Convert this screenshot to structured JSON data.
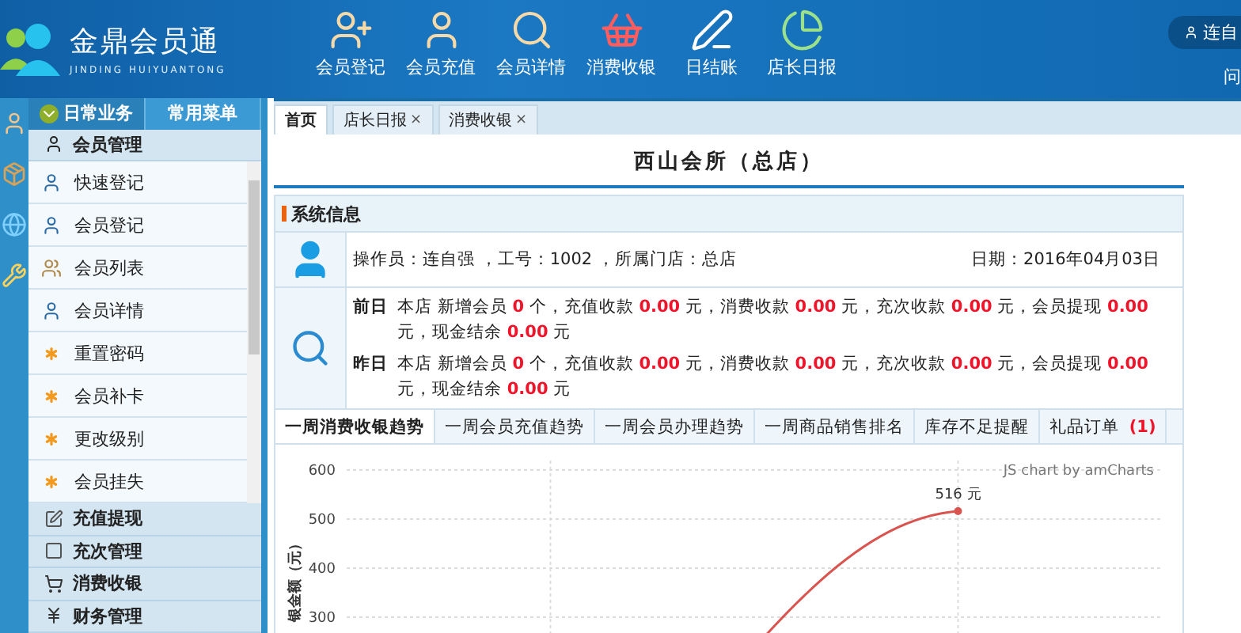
{
  "header": {
    "logo_title": "金鼎会员通",
    "logo_subtitle": "JINDING HUIYUANTONG",
    "user_name": "连自",
    "help_link": "问"
  },
  "toolbar": [
    {
      "label": "会员登记",
      "kind": "member-add"
    },
    {
      "label": "会员充值",
      "kind": "member-charge"
    },
    {
      "label": "会员详情",
      "kind": "member-detail"
    },
    {
      "label": "消费收银",
      "kind": "basket"
    },
    {
      "label": "日结账",
      "kind": "ledger"
    },
    {
      "label": "店长日报",
      "kind": "report"
    }
  ],
  "sidebar": {
    "tabs": [
      {
        "label": "日常业务",
        "selected": true
      },
      {
        "label": "常用菜单",
        "selected": false
      }
    ],
    "groups": [
      {
        "label": "会员管理",
        "kind": "member",
        "expanded": true,
        "items": [
          {
            "label": "快速登记",
            "kind": "person"
          },
          {
            "label": "会员登记",
            "kind": "person"
          },
          {
            "label": "会员列表",
            "kind": "people"
          },
          {
            "label": "会员详情",
            "kind": "person"
          },
          {
            "label": "重置密码",
            "kind": "star"
          },
          {
            "label": "会员补卡",
            "kind": "star"
          },
          {
            "label": "更改级别",
            "kind": "star"
          },
          {
            "label": "会员挂失",
            "kind": "star"
          }
        ]
      },
      {
        "label": "充值提现",
        "kind": "note",
        "expanded": false
      },
      {
        "label": "充次管理",
        "kind": "square",
        "expanded": false
      },
      {
        "label": "消费收银",
        "kind": "cart",
        "expanded": false
      },
      {
        "label": "财务管理",
        "kind": "yen",
        "expanded": false
      }
    ]
  },
  "page_tabs": [
    {
      "label": "首页",
      "selected": true,
      "closable": false
    },
    {
      "label": "店长日报",
      "selected": false,
      "closable": true
    },
    {
      "label": "消费收银",
      "selected": false,
      "closable": true
    }
  ],
  "close_mark": "×",
  "store_title": "西山会所（总店）",
  "system_info": {
    "title": "系统信息",
    "operator": "操作员：连自强 ，工号：1002 ，所属门店：总店",
    "date": "日期：2016年04月03日",
    "days": [
      {
        "label": "前日",
        "text": "本店 新增会员 **0** 个，充值收款 **0.00** 元，消费收款 **0.00** 元，充次收款 **0.00** 元，会员提现 **0.00** 元，现金结余 **0.00** 元"
      },
      {
        "label": "昨日",
        "text": "本店 新增会员 **0** 个，充值收款 **0.00** 元，消费收款 **0.00** 元，充次收款 **0.00** 元，会员提现 **0.00** 元，现金结余 **0.00** 元"
      }
    ]
  },
  "chart_tabs": [
    {
      "label": "一周消费收银趋势",
      "selected": true
    },
    {
      "label": "一周会员充值趋势",
      "selected": false
    },
    {
      "label": "一周会员办理趋势",
      "selected": false
    },
    {
      "label": "一周商品销售排名",
      "selected": false
    },
    {
      "label": "库存不足提醒",
      "selected": false
    },
    {
      "label": "礼品订单 **(1)**",
      "selected": false
    }
  ],
  "chart": {
    "credit": "JS chart by amCharts",
    "chart_data": {
      "type": "line",
      "ylabel": "银金额（元）",
      "ylim": [
        300,
        600
      ],
      "yticks": [
        300,
        400,
        500,
        600
      ],
      "grid": true,
      "value_labels": [
        null,
        "516 元"
      ],
      "series": [
        {
          "color": "#d9534f",
          "marker": true,
          "values": [
            null,
            516
          ]
        }
      ]
    }
  }
}
